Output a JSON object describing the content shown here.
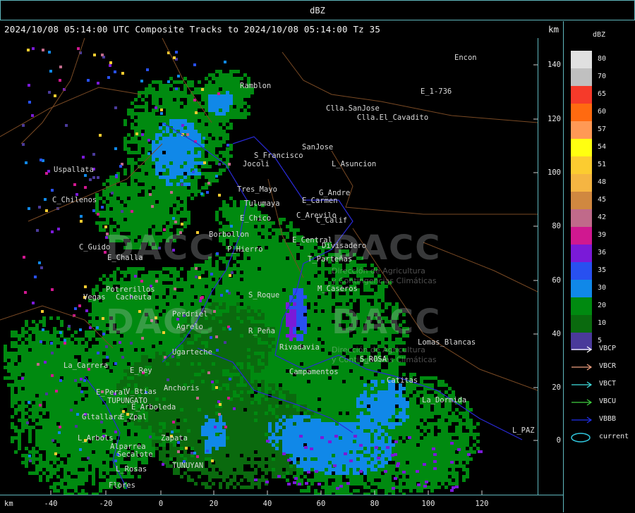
{
  "title": "dBZ",
  "header": {
    "text": "2024/10/08 05:14:00 UTC Composite Tracks to 2024/10/08 05:14:00 Tz 35",
    "unit": "km"
  },
  "y_axis": {
    "unit": "km",
    "ticks": [
      "140",
      "120",
      "100",
      "80",
      "60",
      "40",
      "20",
      "0"
    ]
  },
  "x_axis": {
    "unit": "km",
    "ticks": [
      "-40",
      "-20",
      "0",
      "20",
      "40",
      "60",
      "80",
      "100",
      "120"
    ]
  },
  "legend": {
    "title": "dBZ",
    "levels": [
      {
        "label": "80",
        "color": "#e0e0e0"
      },
      {
        "label": "70",
        "color": "#c0c0c0"
      },
      {
        "label": "65",
        "color": "#f63a2a"
      },
      {
        "label": "60",
        "color": "#ff6a10"
      },
      {
        "label": "57",
        "color": "#ff9955"
      },
      {
        "label": "54",
        "color": "#ffff10"
      },
      {
        "label": "51",
        "color": "#fccc30"
      },
      {
        "label": "48",
        "color": "#f5b542"
      },
      {
        "label": "45",
        "color": "#d08840"
      },
      {
        "label": "42",
        "color": "#c06a8a"
      },
      {
        "label": "39",
        "color": "#d01890"
      },
      {
        "label": "36",
        "color": "#7a1ad8"
      },
      {
        "label": "35",
        "color": "#2850f0"
      },
      {
        "label": "30",
        "color": "#1088e8"
      },
      {
        "label": "20",
        "color": "#008a10"
      },
      {
        "label": "10",
        "color": "#0a6a0e"
      },
      {
        "label": "5",
        "color": "#4a3a9a"
      }
    ],
    "tracks": [
      {
        "label": "VBCP",
        "color": "#ffffff",
        "type": "arrow"
      },
      {
        "label": "VBCR",
        "color": "#f0a080",
        "type": "arrow"
      },
      {
        "label": "VBCT",
        "color": "#40e0e0",
        "type": "arrow"
      },
      {
        "label": "VBCU",
        "color": "#40d040",
        "type": "arrow"
      },
      {
        "label": "VBBB",
        "color": "#2030f0",
        "type": "arrow"
      },
      {
        "label": "current",
        "color": "#30c8e0",
        "type": "ellipse"
      }
    ]
  },
  "places": [
    {
      "name": "Ramblon"
    },
    {
      "name": "Encon"
    },
    {
      "name": "E_1-736"
    },
    {
      "name": "Clla.SanJose"
    },
    {
      "name": "Clla.El_Cavadito"
    },
    {
      "name": "SanJose"
    },
    {
      "name": "S_Francisco"
    },
    {
      "name": "Uspallata"
    },
    {
      "name": "Jocoli"
    },
    {
      "name": "L_Asuncion"
    },
    {
      "name": "Tres_Mayo"
    },
    {
      "name": "G_Andre"
    },
    {
      "name": "E_Carmen"
    },
    {
      "name": "C_Chilenos"
    },
    {
      "name": "Tulumaya"
    },
    {
      "name": "C_Arevilo"
    },
    {
      "name": "E_Chico"
    },
    {
      "name": "C_Calif"
    },
    {
      "name": "Borbollon"
    },
    {
      "name": "E_Central"
    },
    {
      "name": "C_Guido"
    },
    {
      "name": "P_Hierro"
    },
    {
      "name": "Divisadero"
    },
    {
      "name": "E_Challa"
    },
    {
      "name": "T_Parteñas"
    },
    {
      "name": "Potrerillos"
    },
    {
      "name": "Cacheuta"
    },
    {
      "name": "M_Caseros"
    },
    {
      "name": "Vegas"
    },
    {
      "name": "S_Roque"
    },
    {
      "name": "Perdriel"
    },
    {
      "name": "Agrelo"
    },
    {
      "name": "R_Peña"
    },
    {
      "name": "Lomas_Blancas"
    },
    {
      "name": "Ugarteche"
    },
    {
      "name": "Rivadavia"
    },
    {
      "name": "La_Carrera"
    },
    {
      "name": "E_Rey"
    },
    {
      "name": "S_ROSA"
    },
    {
      "name": "Campamentos"
    },
    {
      "name": "Catitas"
    },
    {
      "name": "E_Peral"
    },
    {
      "name": "V_Btias"
    },
    {
      "name": "Anchoris"
    },
    {
      "name": "Zapata"
    },
    {
      "name": "TUPUNGATO"
    },
    {
      "name": "La_Dormida"
    },
    {
      "name": "E_Arboleda"
    },
    {
      "name": "Gltallara"
    },
    {
      "name": "E_Zpal"
    },
    {
      "name": "L_Arbols"
    },
    {
      "name": "L_PAZ"
    },
    {
      "name": "Alparrea"
    },
    {
      "name": "Secalote"
    },
    {
      "name": "L_Rosas"
    },
    {
      "name": "TUNUYAN"
    },
    {
      "name": "Flores"
    }
  ],
  "watermarks": [
    {
      "text": "DACC"
    },
    {
      "text": "DACC"
    }
  ],
  "watermark_sub": [
    {
      "line1": "Dirección de Agricultura",
      "line2": "y Contingencias Climáticas"
    },
    {
      "line1": "Dirección de Agricultura",
      "line2": "y Contingencias Climáticas"
    }
  ]
}
